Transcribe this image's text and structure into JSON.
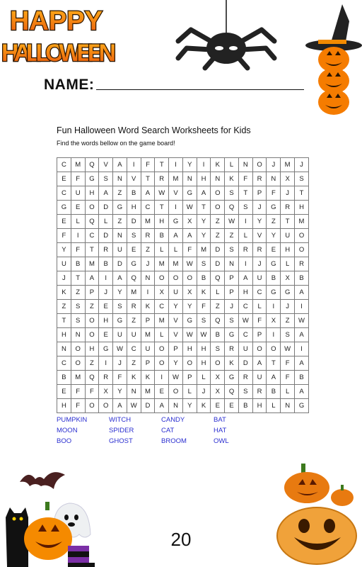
{
  "header": {
    "title_line1": "HAPPY",
    "title_line2": "HALLOWEEN",
    "name_label": "NAME:"
  },
  "worksheet": {
    "title": "Fun Halloween Word Search Worksheets for Kids",
    "instructions": "Find the words bellow on the game board!",
    "grid": [
      [
        "C",
        "M",
        "Q",
        "V",
        "A",
        "I",
        "F",
        "T",
        "I",
        "Y",
        "I",
        "K",
        "L",
        "N",
        "O",
        "J",
        "M",
        "J"
      ],
      [
        "E",
        "F",
        "G",
        "S",
        "N",
        "V",
        "T",
        "R",
        "M",
        "N",
        "H",
        "N",
        "K",
        "F",
        "R",
        "N",
        "X",
        "S"
      ],
      [
        "C",
        "U",
        "H",
        "A",
        "Z",
        "B",
        "A",
        "W",
        "V",
        "G",
        "A",
        "O",
        "S",
        "T",
        "P",
        "F",
        "J",
        "T"
      ],
      [
        "G",
        "E",
        "O",
        "D",
        "G",
        "H",
        "C",
        "T",
        "I",
        "W",
        "T",
        "O",
        "Q",
        "S",
        "J",
        "G",
        "R",
        "H"
      ],
      [
        "E",
        "L",
        "Q",
        "L",
        "Z",
        "D",
        "M",
        "H",
        "G",
        "X",
        "Y",
        "Z",
        "W",
        "I",
        "Y",
        "Z",
        "T",
        "M"
      ],
      [
        "F",
        "I",
        "C",
        "D",
        "N",
        "S",
        "R",
        "B",
        "A",
        "A",
        "Y",
        "Z",
        "Z",
        "L",
        "V",
        "Y",
        "U",
        "O"
      ],
      [
        "Y",
        "F",
        "T",
        "R",
        "U",
        "E",
        "Z",
        "L",
        "L",
        "F",
        "M",
        "D",
        "S",
        "R",
        "R",
        "E",
        "H",
        "O"
      ],
      [
        "U",
        "B",
        "M",
        "B",
        "D",
        "G",
        "J",
        "M",
        "M",
        "W",
        "S",
        "D",
        "N",
        "I",
        "J",
        "G",
        "L",
        "R"
      ],
      [
        "J",
        "T",
        "A",
        "I",
        "A",
        "Q",
        "N",
        "O",
        "O",
        "O",
        "B",
        "Q",
        "P",
        "A",
        "U",
        "B",
        "X",
        "B"
      ],
      [
        "K",
        "Z",
        "P",
        "J",
        "Y",
        "M",
        "I",
        "X",
        "U",
        "X",
        "K",
        "L",
        "P",
        "H",
        "C",
        "G",
        "G",
        "A"
      ],
      [
        "Z",
        "S",
        "Z",
        "E",
        "S",
        "R",
        "K",
        "C",
        "Y",
        "Y",
        "F",
        "Z",
        "J",
        "C",
        "L",
        "I",
        "J",
        "I"
      ],
      [
        "T",
        "S",
        "O",
        "H",
        "G",
        "Z",
        "P",
        "M",
        "V",
        "G",
        "S",
        "Q",
        "S",
        "W",
        "F",
        "X",
        "Z",
        "W"
      ],
      [
        "H",
        "N",
        "O",
        "E",
        "U",
        "U",
        "M",
        "L",
        "V",
        "W",
        "W",
        "B",
        "G",
        "C",
        "P",
        "I",
        "S",
        "A"
      ],
      [
        "N",
        "O",
        "H",
        "G",
        "W",
        "C",
        "U",
        "O",
        "P",
        "H",
        "H",
        "S",
        "R",
        "U",
        "O",
        "O",
        "W",
        "I"
      ],
      [
        "C",
        "O",
        "Z",
        "I",
        "J",
        "Z",
        "P",
        "O",
        "Y",
        "O",
        "H",
        "O",
        "K",
        "D",
        "A",
        "T",
        "F",
        "A"
      ],
      [
        "B",
        "M",
        "Q",
        "R",
        "F",
        "K",
        "K",
        "I",
        "W",
        "P",
        "L",
        "X",
        "G",
        "R",
        "U",
        "A",
        "F",
        "B"
      ],
      [
        "E",
        "F",
        "F",
        "X",
        "Y",
        "N",
        "M",
        "E",
        "O",
        "L",
        "J",
        "X",
        "Q",
        "S",
        "R",
        "B",
        "L",
        "A"
      ],
      [
        "H",
        "F",
        "O",
        "O",
        "A",
        "W",
        "D",
        "A",
        "N",
        "Y",
        "K",
        "E",
        "E",
        "B",
        "H",
        "L",
        "N",
        "G"
      ]
    ],
    "words": [
      "PUMPKIN",
      "WITCH",
      "CANDY",
      "BAT",
      "MOON",
      "SPIDER",
      "CAT",
      "HAT",
      "BOO",
      "GHOST",
      "BROOM",
      "OWL"
    ]
  },
  "footer": {
    "page_number": "20"
  }
}
